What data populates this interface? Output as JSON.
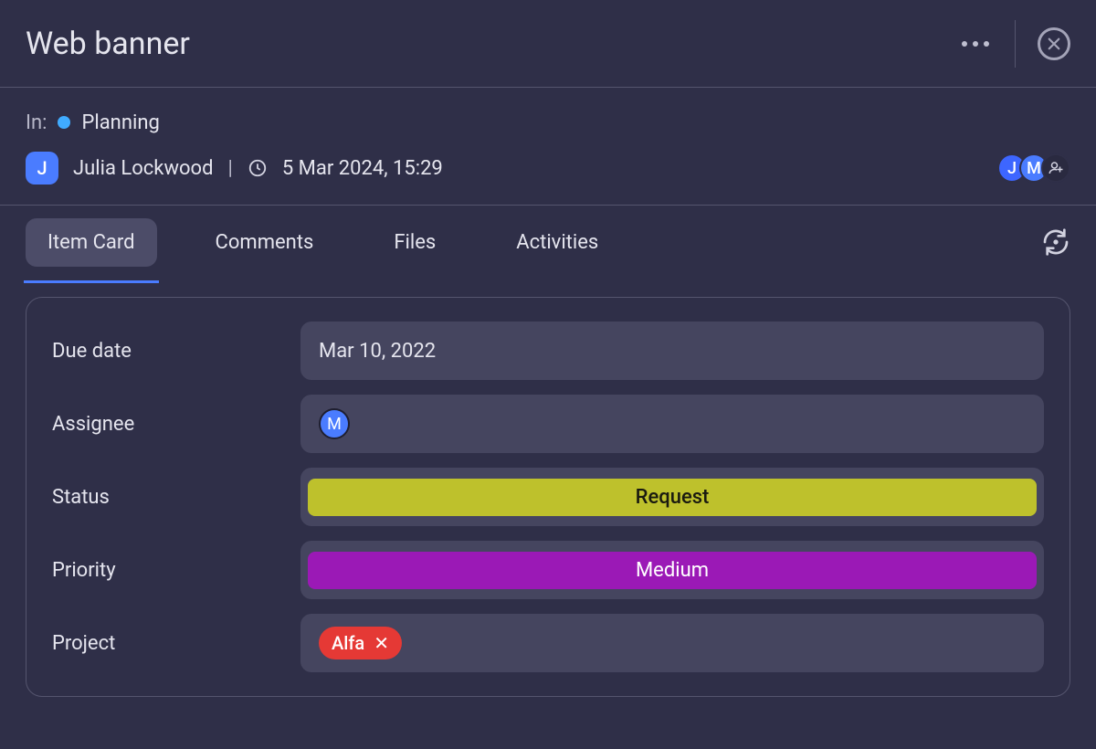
{
  "header": {
    "title": "Web banner"
  },
  "meta": {
    "in_label": "In:",
    "stage": "Planning",
    "author_initial": "J",
    "author_name": "Julia Lockwood",
    "timestamp": "5 Mar 2024, 15:29",
    "watchers": [
      {
        "initial": "J",
        "class": "avatar-j"
      },
      {
        "initial": "M",
        "class": "avatar-m"
      }
    ]
  },
  "tabs": {
    "items": [
      {
        "label": "Item Card",
        "active": true
      },
      {
        "label": "Comments",
        "active": false
      },
      {
        "label": "Files",
        "active": false
      },
      {
        "label": "Activities",
        "active": false
      }
    ]
  },
  "fields": {
    "due_date": {
      "label": "Due date",
      "value": "Mar 10, 2022"
    },
    "assignee": {
      "label": "Assignee",
      "initial": "M"
    },
    "status": {
      "label": "Status",
      "value": "Request",
      "color": "#bec12c"
    },
    "priority": {
      "label": "Priority",
      "value": "Medium",
      "color": "#9b19b6"
    },
    "project": {
      "label": "Project",
      "value": "Alfa",
      "chip_color": "#e53935"
    }
  }
}
